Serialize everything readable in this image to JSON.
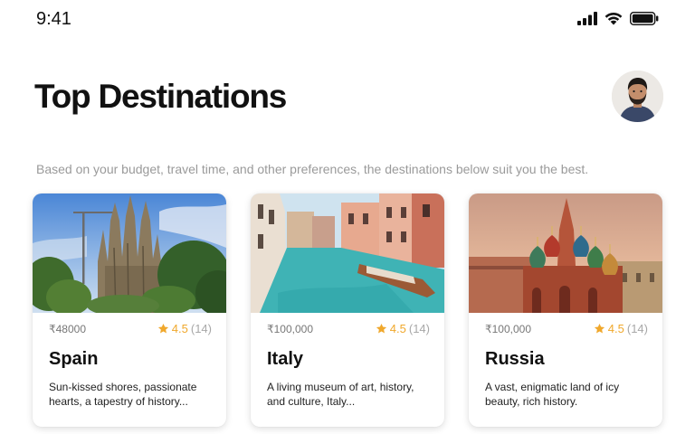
{
  "status_bar": {
    "time": "9:41",
    "icons": [
      "cellular-signal-icon",
      "wifi-icon",
      "battery-icon"
    ]
  },
  "header": {
    "title": "Top Destinations",
    "avatar_icon": "user-avatar"
  },
  "subtitle": "Based on your budget, travel time, and other preferences, the destinations below suit you the best.",
  "colors": {
    "rating_star": "#f0a82c",
    "title_text": "#111111",
    "muted_text": "#9a9a9a"
  },
  "destinations": [
    {
      "name": "Spain",
      "price": "₹48000",
      "rating": "4.5",
      "reviews": "(14)",
      "description": "Sun-kissed shores, passionate hearts, a tapestry of history...",
      "image": "sagrada-familia-photo"
    },
    {
      "name": "Italy",
      "price": "₹100,000",
      "rating": "4.5",
      "reviews": "(14)",
      "description": "A living museum of art, history, and culture, Italy...",
      "image": "venice-canal-photo"
    },
    {
      "name": "Russia",
      "price": "₹100,000",
      "rating": "4.5",
      "reviews": "(14)",
      "description": "A vast, enigmatic land of icy beauty, rich history.",
      "image": "st-basils-cathedral-photo"
    }
  ]
}
